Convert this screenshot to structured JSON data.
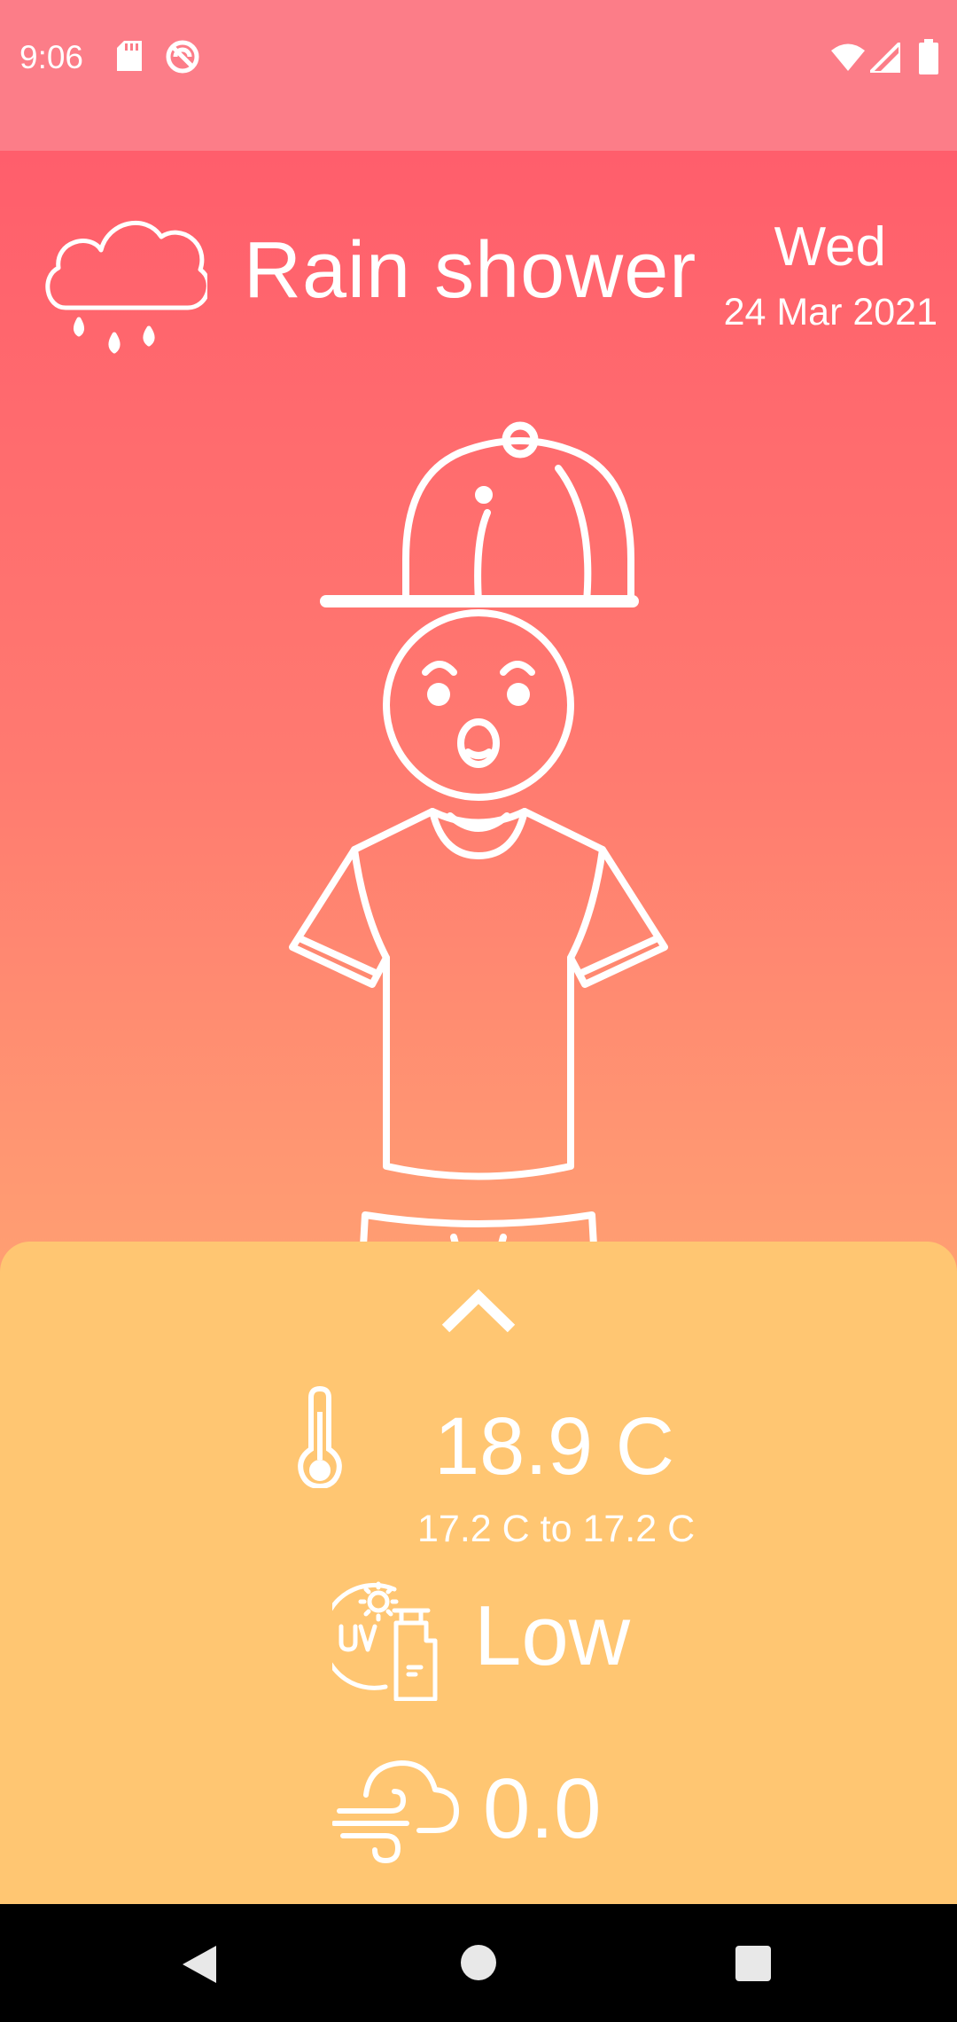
{
  "status_bar": {
    "time": "9:06",
    "icons": [
      "sd-card-icon",
      "dnd-icon",
      "wifi-icon",
      "signal-icon",
      "battery-icon"
    ]
  },
  "weather": {
    "condition": "Rain shower",
    "day": "Wed",
    "date": "24 Mar 2021",
    "icon": "rain-cloud-icon"
  },
  "details": {
    "temperature": "18.9 C",
    "temperature_range": "17.2 C to 17.2 C",
    "uv_index": "Low",
    "wind": "0.0"
  },
  "colors": {
    "status_bar": "#fc7d88",
    "gradient_top": "#ff5e6c",
    "gradient_bottom": "#ffc672",
    "sheet": "#ffc672"
  },
  "nav_bar": {
    "buttons": [
      "back-icon",
      "home-icon",
      "recents-icon"
    ]
  }
}
